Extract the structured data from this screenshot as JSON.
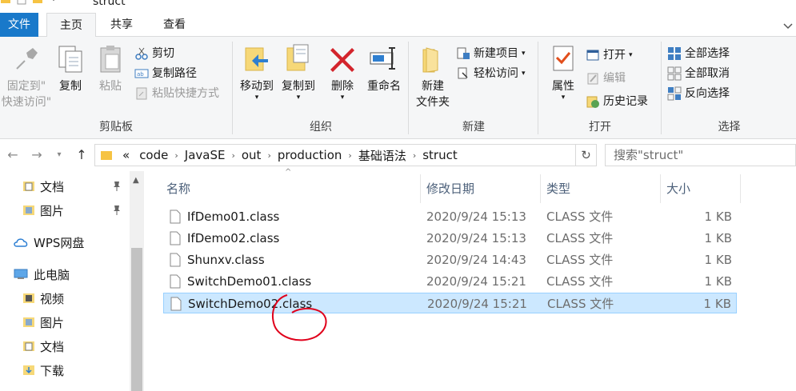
{
  "window": {
    "title": "struct"
  },
  "tabs": {
    "file": "文件",
    "home": "主页",
    "share": "共享",
    "view": "查看"
  },
  "ribbon": {
    "clipboard": {
      "label": "剪贴板",
      "pin_label_1": "固定到\"",
      "pin_label_2": "快速访问\"",
      "copy": "复制",
      "paste": "粘贴",
      "cut": "剪切",
      "copy_path": "复制路径",
      "paste_shortcut": "粘贴快捷方式"
    },
    "organize": {
      "label": "组织",
      "move_to": "移动到",
      "copy_to": "复制到",
      "delete": "删除",
      "rename": "重命名"
    },
    "new": {
      "label": "新建",
      "new_folder_1": "新建",
      "new_folder_2": "文件夹",
      "new_item": "新建项目",
      "easy_access": "轻松访问"
    },
    "open": {
      "label": "打开",
      "properties": "属性",
      "open": "打开",
      "edit": "编辑",
      "history": "历史记录"
    },
    "select": {
      "label": "选择",
      "select_all": "全部选择",
      "select_none": "全部取消",
      "invert": "反向选择"
    }
  },
  "address": {
    "overflow": "«",
    "crumbs": [
      "code",
      "JavaSE",
      "out",
      "production",
      "基础语法",
      "struct"
    ]
  },
  "search": {
    "placeholder": "搜索\"struct\""
  },
  "navpane": {
    "items": [
      {
        "label": "文档",
        "icon": "documents-icon",
        "pinned": true
      },
      {
        "label": "图片",
        "icon": "pictures-icon",
        "pinned": true
      },
      {
        "label": "WPS网盘",
        "icon": "cloud-icon"
      },
      {
        "label": "此电脑",
        "icon": "computer-icon"
      },
      {
        "label": "视频",
        "icon": "videos-icon"
      },
      {
        "label": "图片",
        "icon": "pictures-icon"
      },
      {
        "label": "文档",
        "icon": "documents-icon"
      },
      {
        "label": "下载",
        "icon": "downloads-icon"
      }
    ]
  },
  "columns": {
    "name": "名称",
    "date": "修改日期",
    "type": "类型",
    "size": "大小"
  },
  "files": [
    {
      "name": "IfDemo01.class",
      "date": "2020/9/24 15:13",
      "type": "CLASS 文件",
      "size": "1 KB"
    },
    {
      "name": "IfDemo02.class",
      "date": "2020/9/24 15:13",
      "type": "CLASS 文件",
      "size": "1 KB"
    },
    {
      "name": "Shunxv.class",
      "date": "2020/9/24 14:43",
      "type": "CLASS 文件",
      "size": "1 KB"
    },
    {
      "name": "SwitchDemo01.class",
      "date": "2020/9/24 15:21",
      "type": "CLASS 文件",
      "size": "1 KB"
    },
    {
      "name": "SwitchDemo02.class",
      "date": "2020/9/24 15:21",
      "type": "CLASS 文件",
      "size": "1 KB",
      "selected": true
    }
  ],
  "colors": {
    "accent": "#1979ca",
    "selection": "#cce8ff",
    "annotation": "#e0001b"
  }
}
